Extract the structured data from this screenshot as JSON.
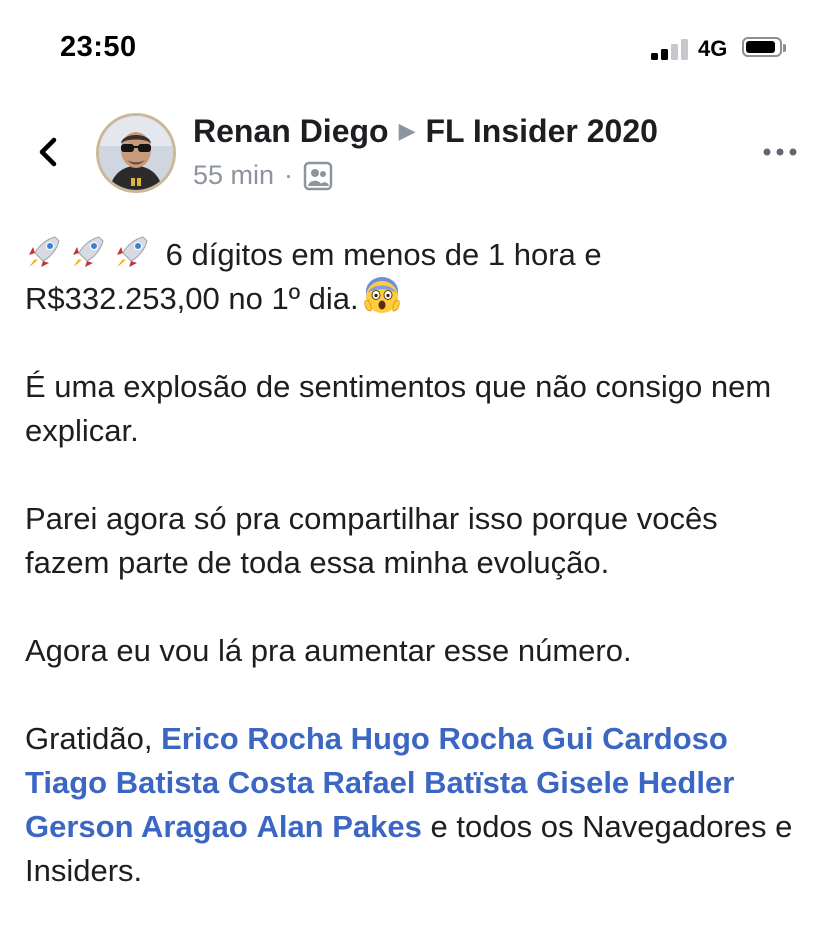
{
  "status_bar": {
    "time": "23:50",
    "network": "4G",
    "signal_bars_filled": 2,
    "signal_bars_total": 4,
    "battery_level": 0.9
  },
  "header": {
    "back_icon": "chevron-left-icon",
    "author": "Renan Diego",
    "separator_icon": "triangle-right-icon",
    "group": "FL Insider 2020",
    "time_ago": "55 min",
    "dot": "·",
    "audience_icon": "group-members-icon",
    "more_icon": "more-horizontal-icon"
  },
  "post": {
    "line1_emojis": [
      "rocket-emoji",
      "rocket-emoji",
      "rocket-emoji"
    ],
    "line1_text": "6 dígitos em menos de 1 hora e",
    "line2_text": "R$332.253,00 no 1º dia.",
    "line2_emoji": "screaming-face-emoji",
    "para2": "É uma explosão de sentimentos que não consigo nem explicar.",
    "para3": "Parei agora só pra compartilhar isso porque vocês fazem parte de toda essa minha evolução.",
    "para4": "Agora eu vou lá pra aumentar esse número.",
    "para5_prefix": "Gratidão, ",
    "mentions": [
      "Erico Rocha",
      "Hugo Rocha",
      "Gui Cardoso",
      "Tiago Batista Costa",
      "Rafael Batïsta",
      "Gisele Hedler",
      "Gerson Aragao",
      "Alan Pakes"
    ],
    "para5_suffix": " e todos os Navegadores e Insiders."
  },
  "colors": {
    "mention": "#3b66c4",
    "meta": "#8d949e",
    "text": "#1c1e21"
  }
}
